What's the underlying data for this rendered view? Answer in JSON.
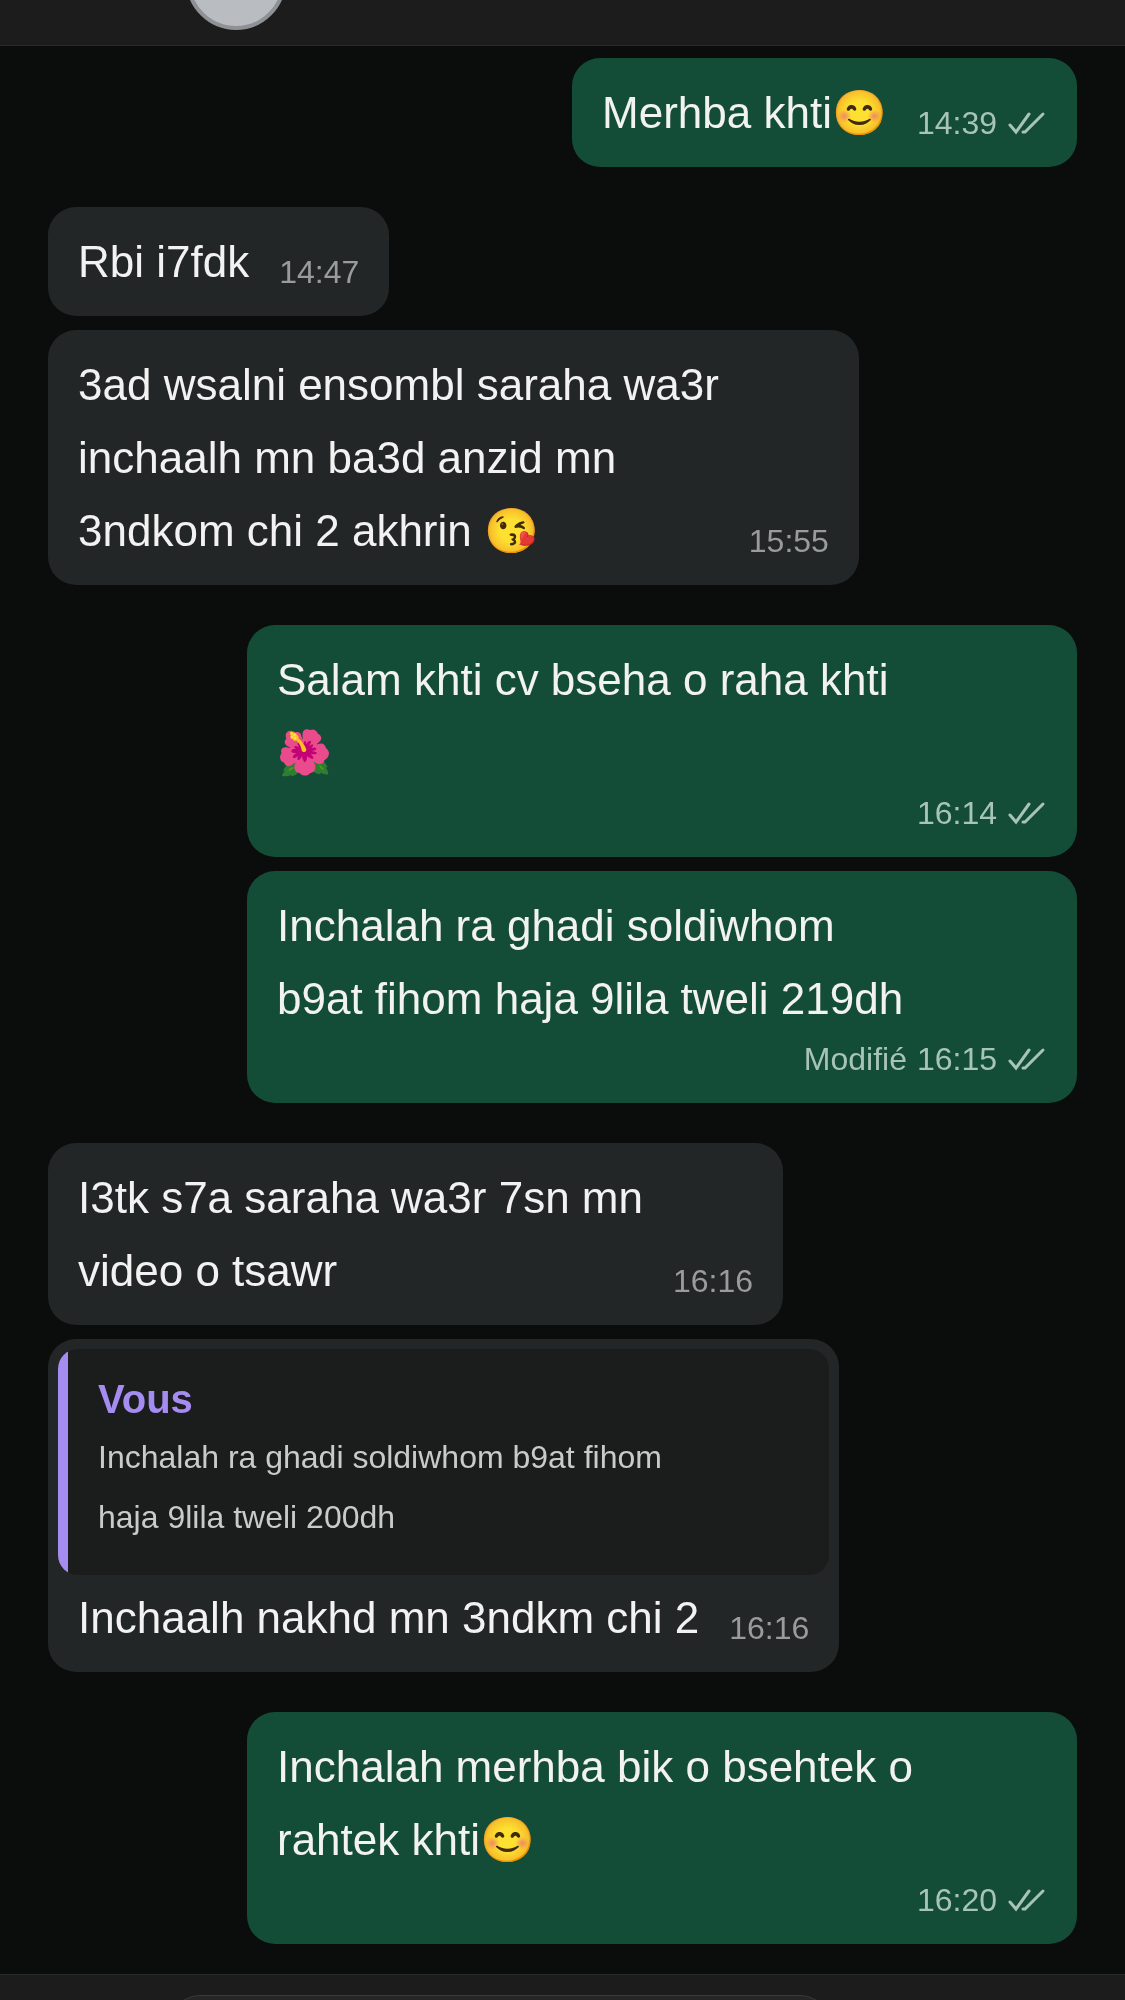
{
  "messages": [
    {
      "kind": "outgoing",
      "lines": [
        "Merhba khti😊"
      ],
      "time": "14:39",
      "double_check": true
    },
    {
      "kind": "incoming",
      "lines": [
        "Rbi i7fdk"
      ],
      "time": "14:47"
    },
    {
      "kind": "incoming",
      "lines": [
        "3ad wsalni ensombl saraha wa3r",
        "inchaalh mn ba3d anzid mn",
        "3ndkom chi 2 akhrin 😘"
      ],
      "time": "15:55"
    },
    {
      "kind": "outgoing",
      "lines": [
        "Salam khti cv bseha o raha khti",
        "🌺"
      ],
      "time": "16:14",
      "double_check": true
    },
    {
      "kind": "outgoing",
      "lines": [
        "Inchalah ra ghadi soldiwhom",
        "b9at fihom haja 9lila tweli 219dh"
      ],
      "edited_label": "Modifié",
      "time": "16:15",
      "double_check": true
    },
    {
      "kind": "incoming",
      "lines": [
        "I3tk s7a saraha wa3r 7sn mn",
        "video o tsawr"
      ],
      "time": "16:16"
    },
    {
      "kind": "incoming",
      "reply": {
        "author": "Vous",
        "lines": [
          "Inchalah ra ghadi soldiwhom b9at fihom",
          "haja 9lila tweli 200dh"
        ]
      },
      "lines": [
        "Inchaalh nakhd mn 3ndkm chi 2"
      ],
      "time": "16:16"
    },
    {
      "kind": "outgoing",
      "lines": [
        "Inchalah merhba bik o bsehtek o",
        "rahtek khti😊"
      ],
      "time": "16:20",
      "double_check": true
    }
  ]
}
